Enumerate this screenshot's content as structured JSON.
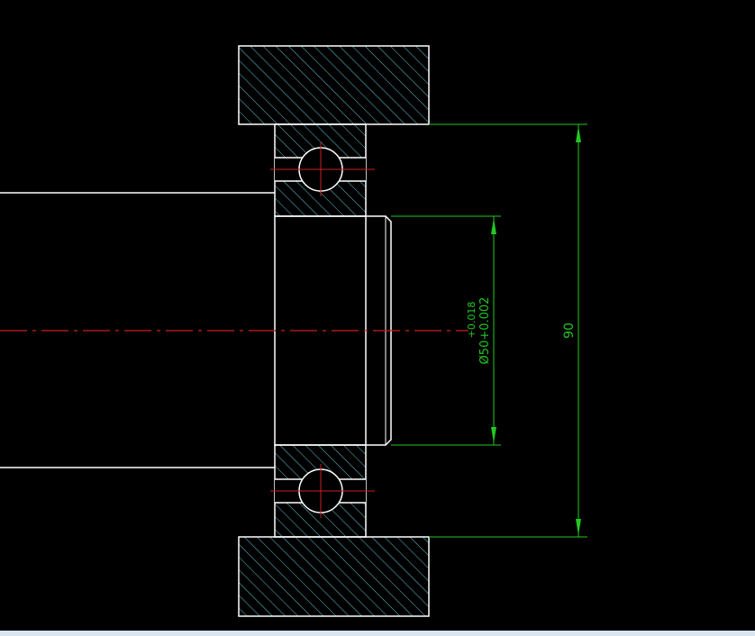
{
  "colors": {
    "background": "#000000",
    "outline": "#ffffff",
    "hatch": "#5ec8d8",
    "centerline": "#cc2020",
    "dimension": "#22c822",
    "statusbar": "#d9e6f2"
  },
  "dimensions": {
    "inner_diameter_label": "Ø50+0.002",
    "inner_tolerance_upper": "+0.018",
    "outer_diameter_label": "90"
  },
  "icons": {
    "arrowhead": "dimension-arrow-icon"
  }
}
